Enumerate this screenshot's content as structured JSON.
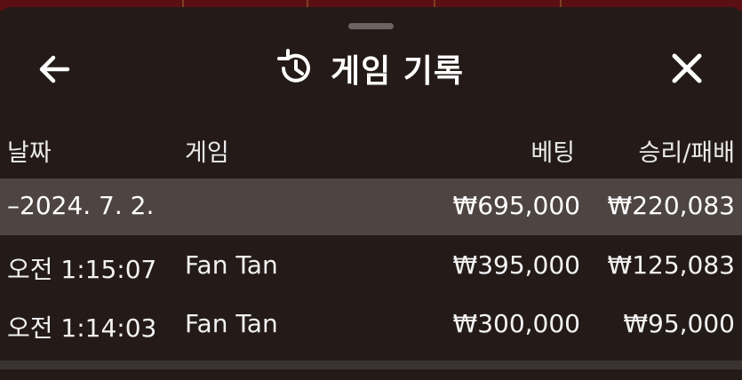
{
  "header": {
    "title": "게임 기록"
  },
  "columns": {
    "date": "날짜",
    "game": "게임",
    "bet": "베팅",
    "win_loss": "승리/패배"
  },
  "date_group": {
    "label": "–2024. 7. 2.",
    "bet": "₩695,000",
    "win_loss": "₩220,083"
  },
  "rows": [
    {
      "time": "오전 1:15:07",
      "game": "Fan Tan",
      "bet": "₩395,000",
      "win_loss": "₩125,083"
    },
    {
      "time": "오전 1:14:03",
      "game": "Fan Tan",
      "bet": "₩300,000",
      "win_loss": "₩95,000"
    }
  ],
  "icons": {
    "back": "arrow-left-icon",
    "history": "history-icon",
    "close": "close-icon"
  }
}
